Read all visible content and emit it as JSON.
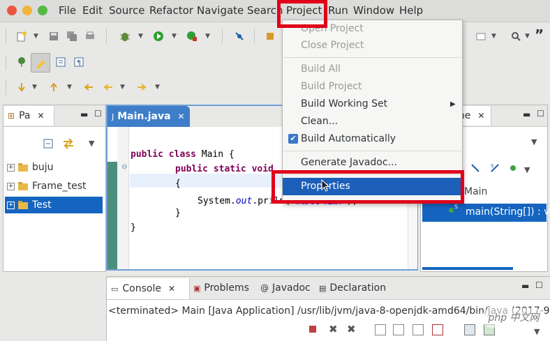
{
  "menubar": {
    "items": [
      "File",
      "Edit",
      "Source",
      "Refactor",
      "Navigate",
      "Search",
      "Project",
      "Run",
      "Window",
      "Help"
    ]
  },
  "toolbar": {
    "overflow_label": "”"
  },
  "package_explorer": {
    "tab_label": "Pa",
    "items": [
      {
        "label": "buju"
      },
      {
        "label": "Frame_test"
      },
      {
        "label": "Test",
        "selected": true
      }
    ]
  },
  "editor": {
    "tab_label": "Main.java",
    "code": {
      "line1_kw": "public class",
      "line1_rest": " Main {",
      "line2_kw": "public static",
      "line2_rest": " void",
      "line3": "{",
      "line4_a": "System.",
      "line4_field": "out",
      "line4_b": ".pr",
      "line4_c": "ln(",
      "line4_str": "\"流美宇链接\"",
      "line4_d": ");",
      "line5": "}",
      "line6": "}"
    }
  },
  "outline": {
    "tab_label": "ine",
    "items": [
      {
        "label": "Main"
      },
      {
        "label": "main(String[]) : v",
        "selected": true
      }
    ]
  },
  "bottom": {
    "tabs": [
      "Console",
      "Problems",
      "Javadoc",
      "Declaration"
    ],
    "console_text": "<terminated> Main [Java Application] /usr/lib/jvm/java-8-openjdk-amd64/bin/java (2017-9-2"
  },
  "project_menu": {
    "items": [
      {
        "label": "Open Project",
        "enabled": false
      },
      {
        "label": "Close Project",
        "enabled": false
      },
      {
        "label": "Build All",
        "enabled": false
      },
      {
        "label": "Build Project",
        "enabled": false
      },
      {
        "label": "Build Working Set",
        "enabled": true,
        "submenu": true
      },
      {
        "label": "Clean...",
        "enabled": true
      },
      {
        "label": "Build Automatically",
        "enabled": true,
        "checked": true
      },
      {
        "label": "Generate Javadoc...",
        "enabled": true
      },
      {
        "label": "Properties",
        "enabled": true,
        "highlighted": true
      }
    ]
  },
  "watermark": "php 中文网",
  "colors": {
    "selection": "#1565c0",
    "highlight_red": "#e0001a",
    "menu_highlight": "#1b5fb8"
  }
}
